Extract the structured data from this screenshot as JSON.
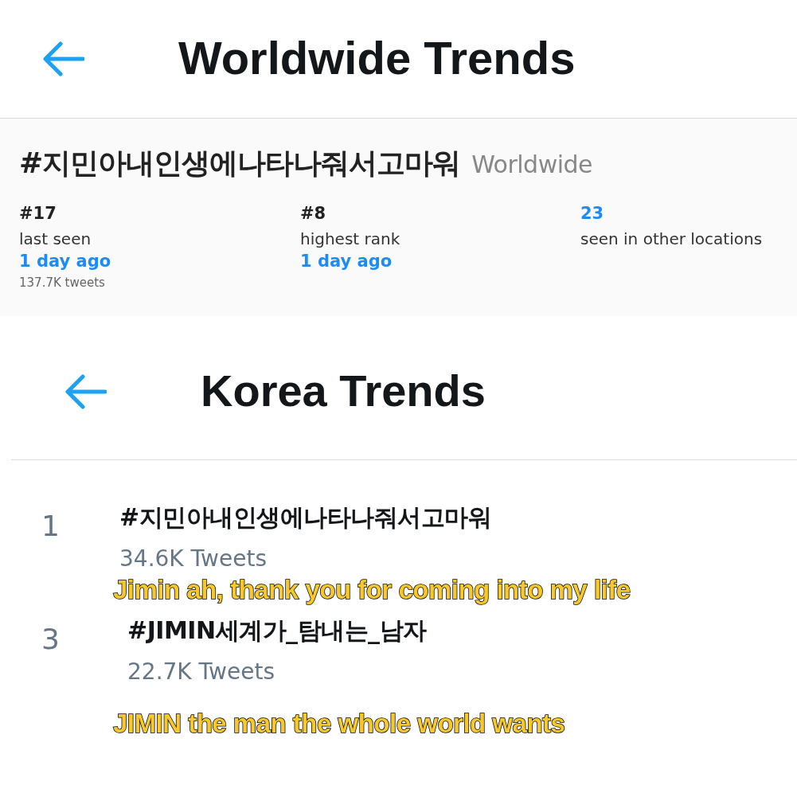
{
  "worldwide": {
    "title": "Worldwide Trends",
    "hashtag": "#지민아내인생에나타나줘서고마워",
    "location": "Worldwide",
    "stats": [
      {
        "value": "#17",
        "label": "last seen",
        "time": "1 day ago",
        "tweets": "137.7K tweets",
        "kind": "plain"
      },
      {
        "value": "#8",
        "label": "highest rank",
        "time": "1 day ago",
        "kind": "plain"
      },
      {
        "value": "23",
        "label": "seen in other locations",
        "kind": "link"
      }
    ]
  },
  "korea": {
    "title": "Korea Trends",
    "trends": [
      {
        "rank": "1",
        "hashtag": "#지민아내인생에나타나줘서고마워",
        "tweets": "34.6K Tweets",
        "caption": "Jimin ah, thank you for coming into my life"
      },
      {
        "rank": "3",
        "hashtag": "#JIMIN세계가_탐내는_남자",
        "tweets": "22.7K Tweets",
        "caption": "JIMIN the man the whole world wants"
      }
    ]
  }
}
